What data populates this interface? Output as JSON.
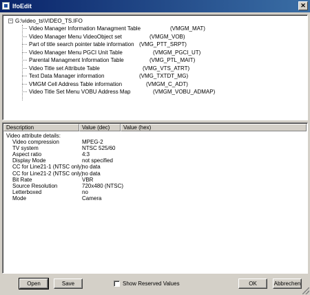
{
  "window": {
    "title": "IfoEdit",
    "close_glyph": "✕"
  },
  "tree": {
    "root_label": "G:\\video_ts\\VIDEO_TS.IFO",
    "expander": "−",
    "items": [
      {
        "name": "Video Manager Information Managment Table",
        "code": "(VMGM_MAT)"
      },
      {
        "name": "Video Manager Menu VideoObject set",
        "code": "(VMGM_VOB)"
      },
      {
        "name": "Part of title search pointer table information",
        "code": "(VMG_PTT_SRPT)"
      },
      {
        "name": "Video Manager Menu PGCI Unit Table",
        "code": "(VMGM_PGCI_UT)"
      },
      {
        "name": "Parental Managment Information Table",
        "code": "(VMG_PTL_MAIT)"
      },
      {
        "name": "Video Title set Attribute Table",
        "code": "(VMG_VTS_ATRT)"
      },
      {
        "name": "Text Data Manager information",
        "code": "(VMG_TXTDT_MG)"
      },
      {
        "name": "VMGM Cell Address Table information",
        "code": "(VMGM_C_ADT)"
      },
      {
        "name": "Video Title Set Menu VOBU Address Map",
        "code": "(VMGM_VOBU_ADMAP)"
      }
    ]
  },
  "table": {
    "columns": [
      "Description",
      "Value (dec)",
      "Value (hex)"
    ],
    "section_label": "Video attribute details:",
    "rows": [
      {
        "label": "Video compression",
        "value": "MPEG-2"
      },
      {
        "label": "TV system",
        "value": "NTSC 525/60"
      },
      {
        "label": "Aspect ratio",
        "value": "4:3"
      },
      {
        "label": "Display Mode",
        "value": "not specified"
      },
      {
        "label": "CC for Line21-1 (NTSC only)",
        "value": "no data"
      },
      {
        "label": "CC for Line21-2 (NTSC only)",
        "value": "no data"
      },
      {
        "label": "Bit Rate",
        "value": "VBR"
      },
      {
        "label": "Source Resolution",
        "value": "720x480 (NTSC)"
      },
      {
        "label": "Letterboxed",
        "value": "no"
      },
      {
        "label": "Mode",
        "value": "Camera"
      }
    ]
  },
  "buttons": {
    "open": "Open",
    "save": "Save",
    "ok": "OK",
    "cancel": "Abbrechen"
  },
  "show_reserved": {
    "label": "Show Reserved Values",
    "checked": false
  }
}
